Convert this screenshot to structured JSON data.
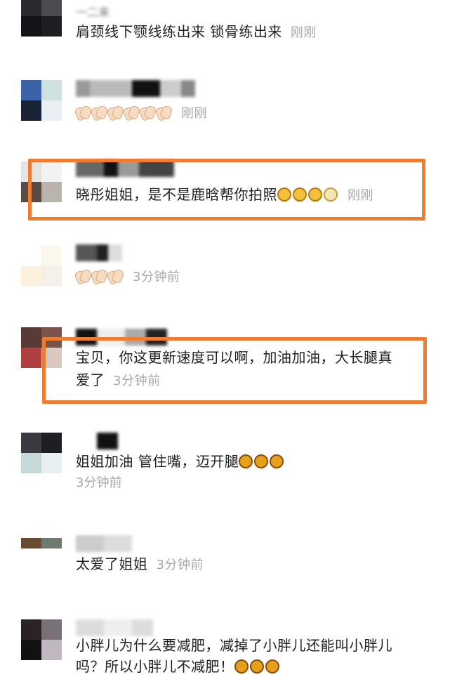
{
  "comments": [
    {
      "text": "肩颈线下颚线练出来 锁骨练出来",
      "time": "刚刚",
      "name_fragment": "一二来"
    },
    {
      "text": "",
      "time": "刚刚",
      "claps": 6
    },
    {
      "text": "晓彤姐姐，是不是鹿晗帮你拍照",
      "time": "刚刚",
      "emoji": [
        "grin",
        "grin",
        "grin",
        "pale"
      ]
    },
    {
      "text": "",
      "time": "3分钟前",
      "claps": 3
    },
    {
      "line1": "宝贝，你这更新速度可以啊，加油加油，大长腿真",
      "line2": "爱了",
      "time": "3分钟前"
    },
    {
      "text": "姐姐加油 管住嘴，迈开腿",
      "time": "3分钟前",
      "emoji": [
        "laugh",
        "laugh",
        "laugh"
      ]
    },
    {
      "text": "太爱了姐姐",
      "time": "3分钟前"
    },
    {
      "line1": "小胖儿为什么要减肥，减掉了小胖儿还能叫小胖儿",
      "line2": "吗？所以小胖儿不减肥！"
    }
  ],
  "colors": {
    "highlight": "#ee7d32",
    "time": "#a7a7a7"
  }
}
